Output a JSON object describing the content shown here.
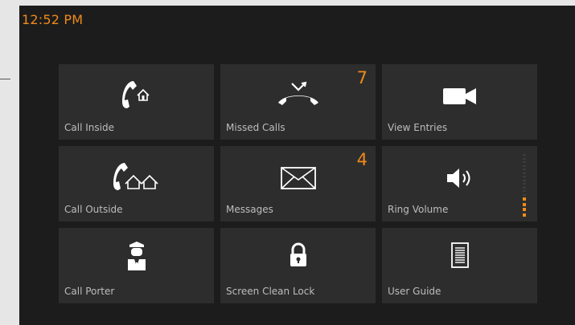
{
  "status": {
    "time": "12:52 PM"
  },
  "colors": {
    "accent": "#f08a1a",
    "tile_bg": "#2d2d2d",
    "screen_bg": "#1c1c1c",
    "label": "#bdbdbd",
    "icon": "#ffffff"
  },
  "tiles": [
    {
      "label": "Call Inside",
      "icon": "phone-home-icon",
      "badge": ""
    },
    {
      "label": "Missed Calls",
      "icon": "missed-call-icon",
      "badge": "7"
    },
    {
      "label": "View Entries",
      "icon": "video-camera-icon",
      "badge": ""
    },
    {
      "label": "Call Outside",
      "icon": "phone-houses-icon",
      "badge": ""
    },
    {
      "label": "Messages",
      "icon": "envelope-icon",
      "badge": "4"
    },
    {
      "label": "Ring Volume",
      "icon": "speaker-icon",
      "badge": ""
    },
    {
      "label": "Call Porter",
      "icon": "porter-icon",
      "badge": ""
    },
    {
      "label": "Screen Clean Lock",
      "icon": "lock-icon",
      "badge": ""
    },
    {
      "label": "User Guide",
      "icon": "document-icon",
      "badge": ""
    }
  ],
  "ring_volume": {
    "level": 4,
    "max": 16
  }
}
